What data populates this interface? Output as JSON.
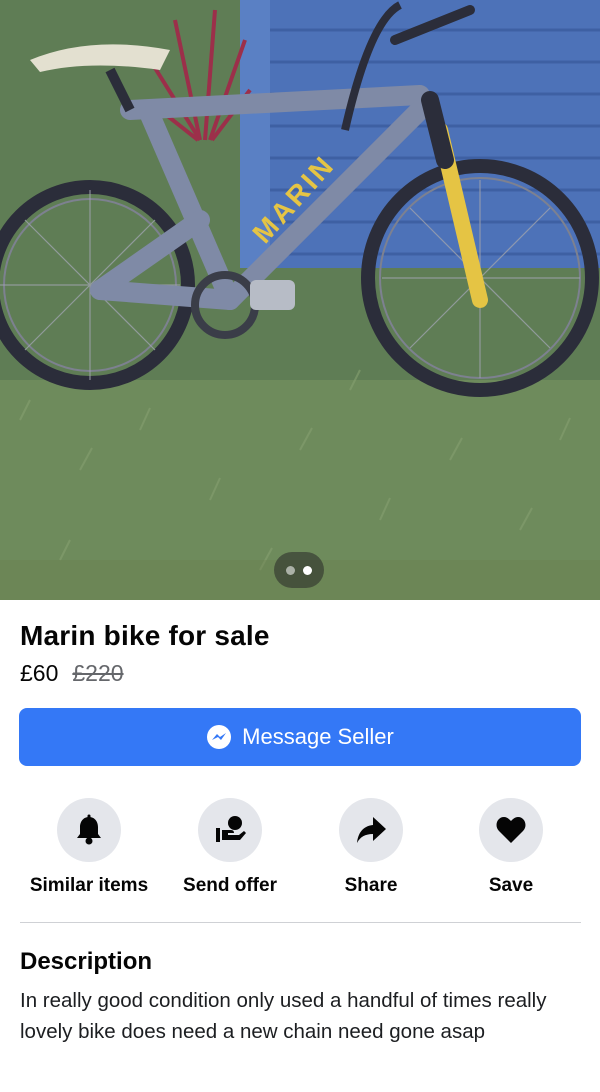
{
  "listing": {
    "photo_alt": "Marin bike for sale",
    "photo_count": 2,
    "active_photo_index": 1,
    "title": "Marin bike for sale",
    "price": "£60",
    "original_price": "£220"
  },
  "primary_action": {
    "label": "Message Seller",
    "icon": "messenger-icon",
    "color": "#3478f6"
  },
  "actions": [
    {
      "label": "Similar items",
      "icon": "bell-icon"
    },
    {
      "label": "Send offer",
      "icon": "offer-hand-icon"
    },
    {
      "label": "Share",
      "icon": "share-arrow-icon"
    },
    {
      "label": "Save",
      "icon": "heart-icon"
    }
  ],
  "description": {
    "heading": "Description",
    "text": "In really good condition only used a handful of times really lovely bike does need a new chain need gone asap"
  }
}
